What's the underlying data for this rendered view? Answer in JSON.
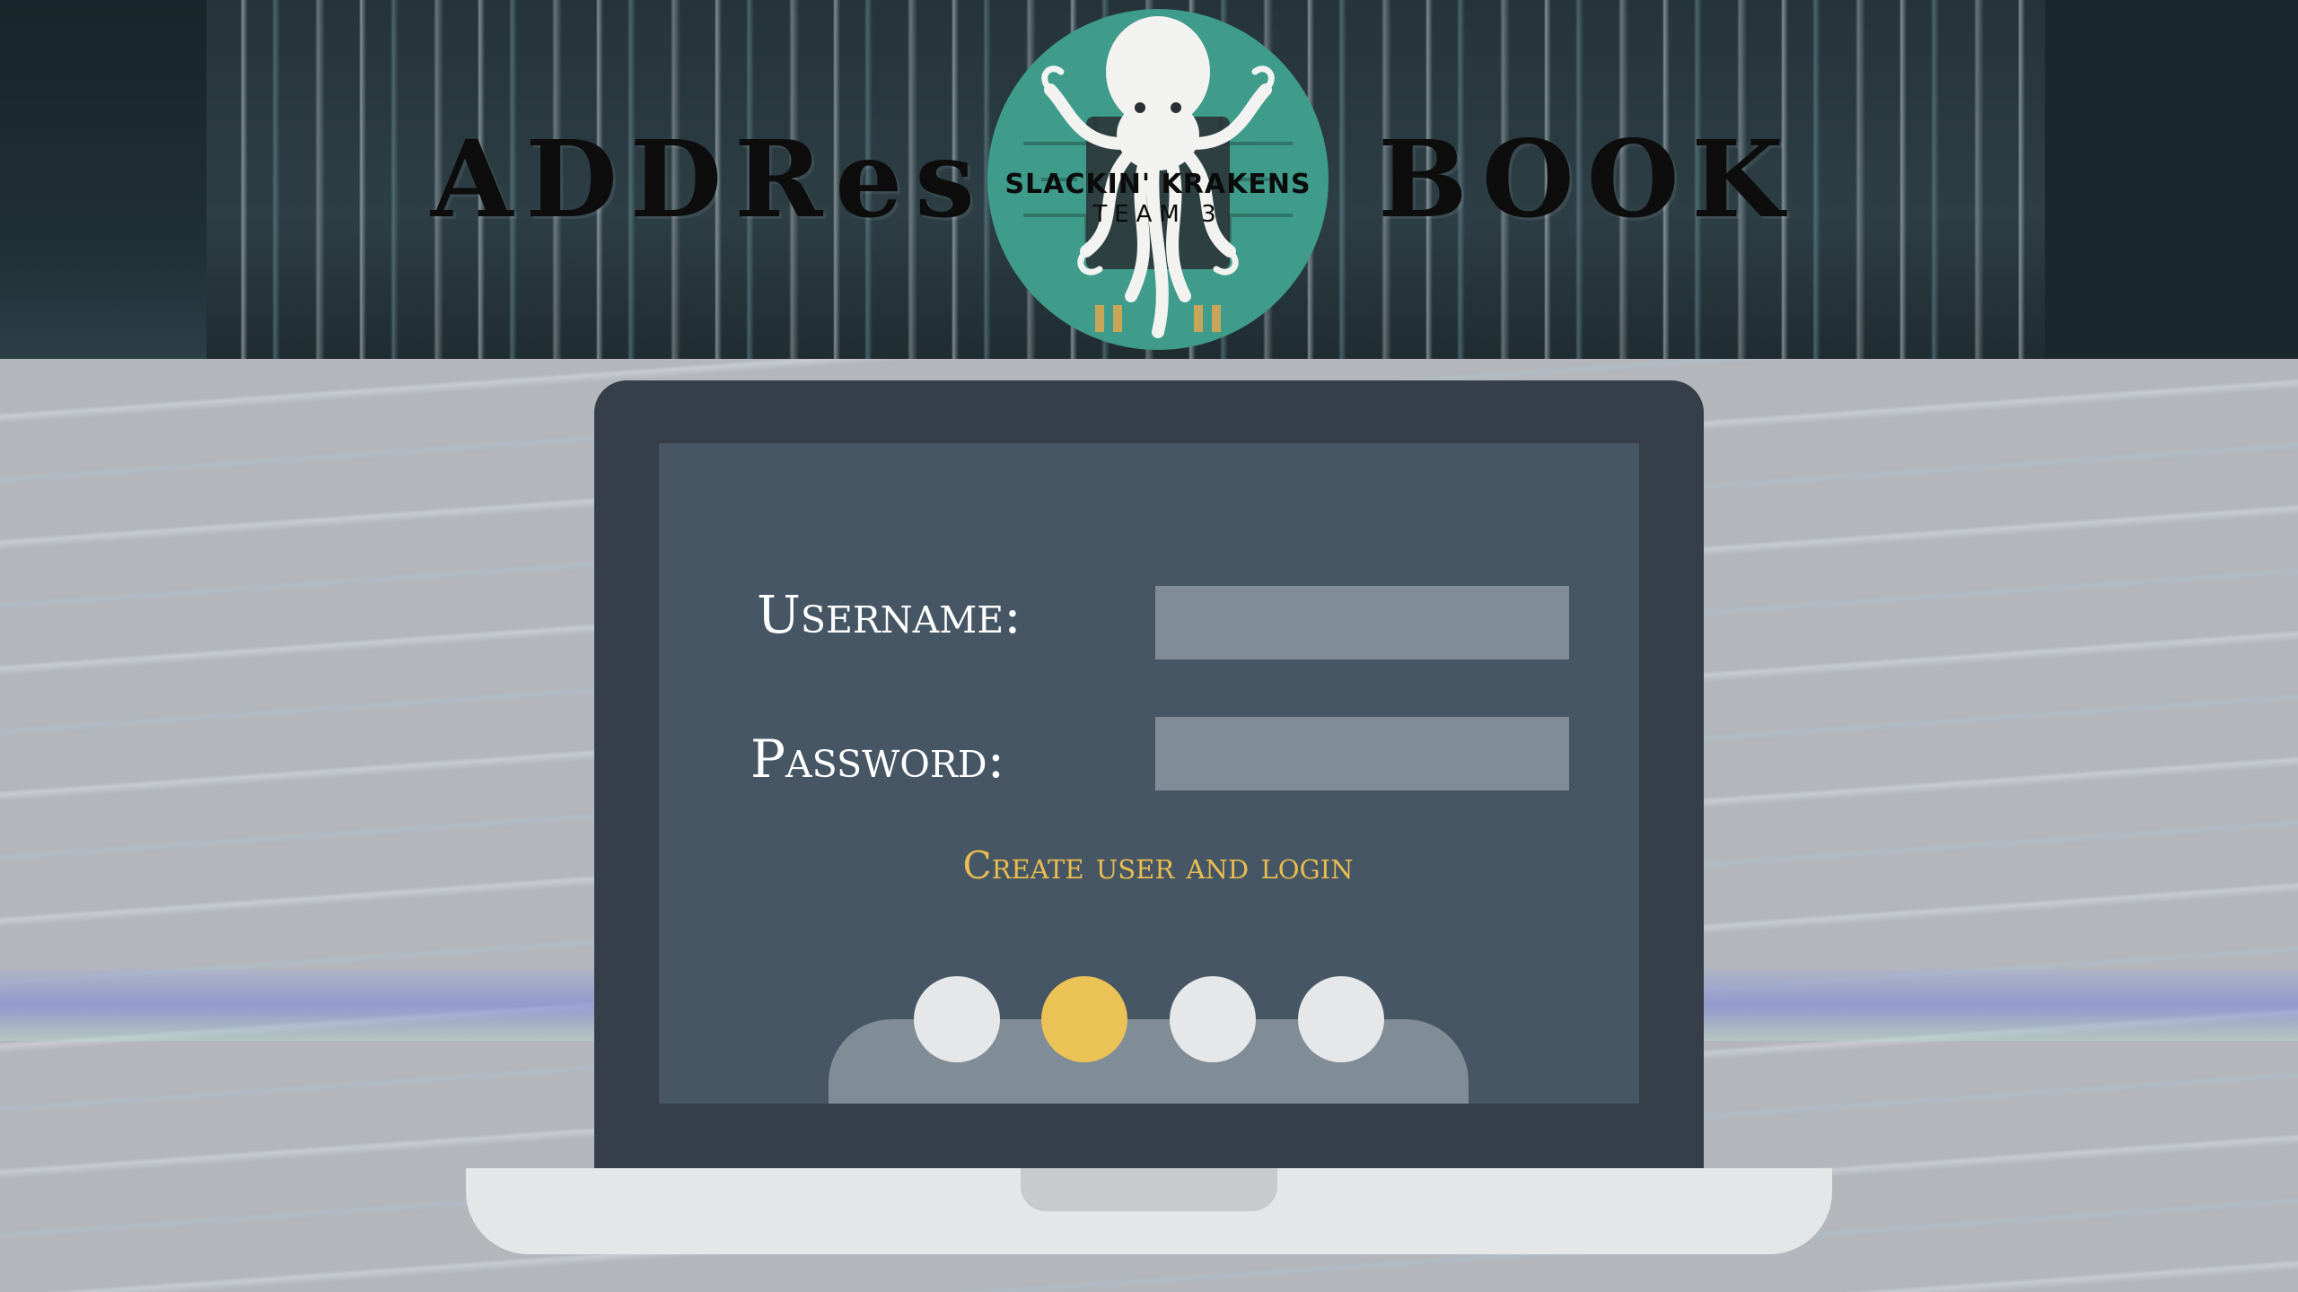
{
  "header": {
    "title_left": "ADDRess",
    "title_right": "BOOK",
    "logo": {
      "line1": "SLACKIN' KRAKENS",
      "line2": "TEAM 3",
      "icon": "kraken-icon",
      "color": "#3f9b8a"
    }
  },
  "form": {
    "username_label": "Username:",
    "username_value": "",
    "password_label": "Password:",
    "password_value": "",
    "create_link": "Create user and login"
  },
  "dock": {
    "dots": 4,
    "active_index": 1,
    "active_color": "#eac255",
    "inactive_color": "#e6e7e8"
  },
  "colors": {
    "accent": "#e9bc4f",
    "screen": "#465664",
    "lid": "#363e49"
  }
}
